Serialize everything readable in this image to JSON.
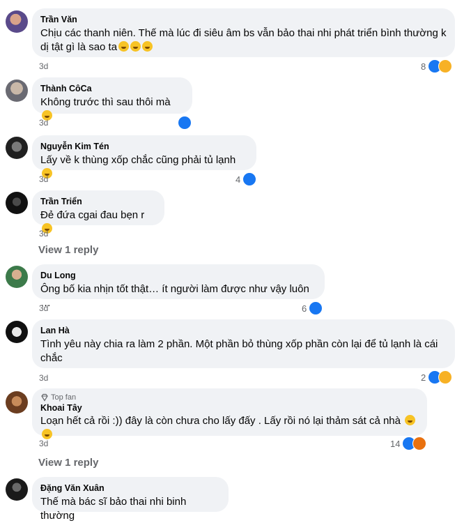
{
  "comments": [
    {
      "author": "Trần Văn",
      "line1": "Chịu các thanh niên. Thế mà lúc đi siêu âm bs vẫn bảo thai nhi phát triển bình thường k",
      "line2": "dị tật gì là sao ta",
      "time": "3d",
      "reactions": "8"
    },
    {
      "author": "Thành CôCa",
      "text": "Không trước thì sau thôi mà",
      "time": "3d",
      "reactions": ""
    },
    {
      "author": "Nguyễn Kim Tén",
      "text": "Lấy về k thùng xốp chắc cũng phải tủ lạnh",
      "time": "3d",
      "reactions": "4"
    },
    {
      "author": "Trần Triển",
      "text": "Đẻ đứa cgai đau bẹn r",
      "time": "3d",
      "view_replies": "View 1 reply"
    },
    {
      "author": "Du Long",
      "text": "Ông bố kia nhịn tốt thật… ít người làm được như vậy luôn …",
      "time": "3d",
      "reactions": "6"
    },
    {
      "author": "Lan Hà",
      "line1": "Tình yêu này chia ra làm 2 phần. Một phần bỏ thùng xốp phần còn lại để tủ lạnh là cái",
      "line2": "chắc",
      "time": "3d",
      "reactions": "2"
    },
    {
      "badge": "Top fan",
      "author": "Khoai Tây",
      "text": "Loạn hết cả rồi :)) đây là còn chưa cho lấy đấy . Lấy rồi nó lại thảm sát cả nhà",
      "time": "3d",
      "reactions": "14",
      "view_replies": "View 1 reply"
    },
    {
      "author": "Đặng Văn Xuân",
      "text": "Thế mà bác sĩ bảo thai nhi binh thường"
    }
  ],
  "colors": {
    "like": "#1877f2",
    "haha": "#f7b125",
    "angry": "#e9710f",
    "bubble": "#f0f2f5",
    "meta": "#65676b"
  },
  "icons": [
    "like-icon",
    "haha-icon",
    "angry-icon",
    "diamond-icon"
  ]
}
